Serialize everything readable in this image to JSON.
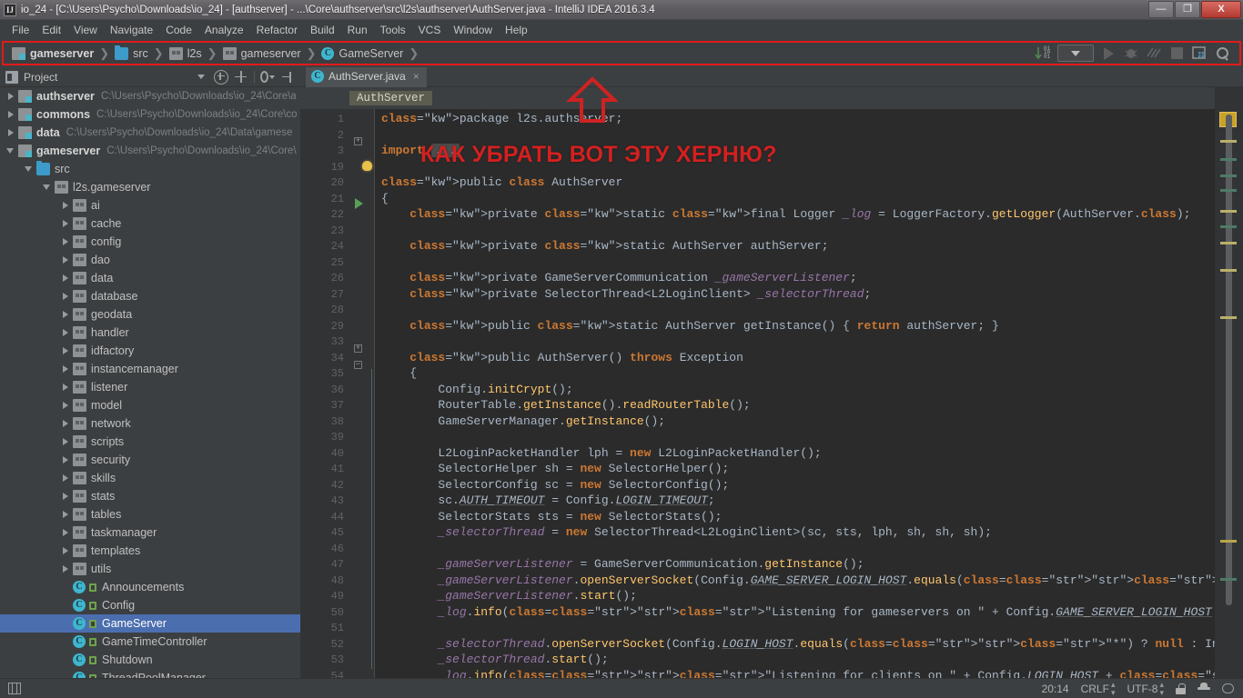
{
  "window": {
    "app_icon": "intellij-idea-icon",
    "title": "io_24 - [C:\\Users\\Psycho\\Downloads\\io_24] - [authserver] - ...\\Core\\authserver\\src\\l2s\\authserver\\AuthServer.java - IntelliJ IDEA 2016.3.4",
    "minimize_label": "—",
    "maximize_label": "❐",
    "close_label": "X"
  },
  "menubar": {
    "items": [
      "File",
      "Edit",
      "View",
      "Navigate",
      "Code",
      "Analyze",
      "Refactor",
      "Build",
      "Run",
      "Tools",
      "VCS",
      "Window",
      "Help"
    ]
  },
  "navbar": {
    "highlight_color": "#e01b1b",
    "crumbs": [
      {
        "label": "gameserver",
        "icon": "module-icon",
        "bold": true
      },
      {
        "label": "src",
        "icon": "source-folder-icon",
        "bold": false
      },
      {
        "label": "l2s",
        "icon": "package-icon",
        "bold": false
      },
      {
        "label": "gameserver",
        "icon": "package-icon",
        "bold": false
      },
      {
        "label": "GameServer",
        "icon": "java-class-icon",
        "bold": false
      }
    ],
    "separator": "❯",
    "tools": [
      "sort-updown-icon",
      "run-configuration-selector",
      "run-icon",
      "debug-icon",
      "coverage-icon",
      "stop-icon",
      "project-structure-icon",
      "search-everywhere-icon"
    ]
  },
  "toolwindow": {
    "icon": "project-tool-icon",
    "title": "Project",
    "dropdown": "▾",
    "actions": [
      "expand-all-icon",
      "collapse-all-icon",
      "settings-gear-icon",
      "hide-icon"
    ]
  },
  "editor_tab": {
    "icon": "java-class-icon",
    "name": "AuthServer.java",
    "close": "×"
  },
  "project_tree": {
    "nodes": [
      {
        "indent": 0,
        "toggle": "right",
        "icon": "module-icon",
        "label": "authserver",
        "bold": true,
        "path": "C:\\Users\\Psycho\\Downloads\\io_24\\Core\\a"
      },
      {
        "indent": 0,
        "toggle": "right",
        "icon": "module-icon",
        "label": "commons",
        "bold": true,
        "path": "C:\\Users\\Psycho\\Downloads\\io_24\\Core\\co"
      },
      {
        "indent": 0,
        "toggle": "right",
        "icon": "module-icon",
        "label": "data",
        "bold": true,
        "path": "C:\\Users\\Psycho\\Downloads\\io_24\\Data\\gamese"
      },
      {
        "indent": 0,
        "toggle": "down",
        "icon": "module-icon",
        "label": "gameserver",
        "bold": true,
        "path": "C:\\Users\\Psycho\\Downloads\\io_24\\Core\\"
      },
      {
        "indent": 1,
        "toggle": "down",
        "icon": "source-folder-icon",
        "label": "src",
        "bold": false,
        "path": ""
      },
      {
        "indent": 2,
        "toggle": "down",
        "icon": "package-icon",
        "label": "l2s.gameserver",
        "bold": false,
        "path": ""
      },
      {
        "indent": 3,
        "toggle": "right",
        "icon": "package-icon",
        "label": "ai",
        "bold": false,
        "path": ""
      },
      {
        "indent": 3,
        "toggle": "right",
        "icon": "package-icon",
        "label": "cache",
        "bold": false,
        "path": ""
      },
      {
        "indent": 3,
        "toggle": "right",
        "icon": "package-icon",
        "label": "config",
        "bold": false,
        "path": ""
      },
      {
        "indent": 3,
        "toggle": "right",
        "icon": "package-icon",
        "label": "dao",
        "bold": false,
        "path": ""
      },
      {
        "indent": 3,
        "toggle": "right",
        "icon": "package-icon",
        "label": "data",
        "bold": false,
        "path": ""
      },
      {
        "indent": 3,
        "toggle": "right",
        "icon": "package-icon",
        "label": "database",
        "bold": false,
        "path": ""
      },
      {
        "indent": 3,
        "toggle": "right",
        "icon": "package-icon",
        "label": "geodata",
        "bold": false,
        "path": ""
      },
      {
        "indent": 3,
        "toggle": "right",
        "icon": "package-icon",
        "label": "handler",
        "bold": false,
        "path": ""
      },
      {
        "indent": 3,
        "toggle": "right",
        "icon": "package-icon",
        "label": "idfactory",
        "bold": false,
        "path": ""
      },
      {
        "indent": 3,
        "toggle": "right",
        "icon": "package-icon",
        "label": "instancemanager",
        "bold": false,
        "path": ""
      },
      {
        "indent": 3,
        "toggle": "right",
        "icon": "package-icon",
        "label": "listener",
        "bold": false,
        "path": ""
      },
      {
        "indent": 3,
        "toggle": "right",
        "icon": "package-icon",
        "label": "model",
        "bold": false,
        "path": ""
      },
      {
        "indent": 3,
        "toggle": "right",
        "icon": "package-icon",
        "label": "network",
        "bold": false,
        "path": ""
      },
      {
        "indent": 3,
        "toggle": "right",
        "icon": "package-icon",
        "label": "scripts",
        "bold": false,
        "path": ""
      },
      {
        "indent": 3,
        "toggle": "right",
        "icon": "package-icon",
        "label": "security",
        "bold": false,
        "path": ""
      },
      {
        "indent": 3,
        "toggle": "right",
        "icon": "package-icon",
        "label": "skills",
        "bold": false,
        "path": ""
      },
      {
        "indent": 3,
        "toggle": "right",
        "icon": "package-icon",
        "label": "stats",
        "bold": false,
        "path": ""
      },
      {
        "indent": 3,
        "toggle": "right",
        "icon": "package-icon",
        "label": "tables",
        "bold": false,
        "path": ""
      },
      {
        "indent": 3,
        "toggle": "right",
        "icon": "package-icon",
        "label": "taskmanager",
        "bold": false,
        "path": ""
      },
      {
        "indent": 3,
        "toggle": "right",
        "icon": "package-icon",
        "label": "templates",
        "bold": false,
        "path": ""
      },
      {
        "indent": 3,
        "toggle": "right",
        "icon": "package-icon",
        "label": "utils",
        "bold": false,
        "path": ""
      },
      {
        "indent": 3,
        "toggle": "none",
        "icon": "java-class-icon",
        "label": "Announcements",
        "bold": false,
        "path": ""
      },
      {
        "indent": 3,
        "toggle": "none",
        "icon": "java-class-icon",
        "label": "Config",
        "bold": false,
        "path": ""
      },
      {
        "indent": 3,
        "toggle": "none",
        "icon": "java-class-icon",
        "label": "GameServer",
        "bold": false,
        "path": "",
        "selected": true
      },
      {
        "indent": 3,
        "toggle": "none",
        "icon": "java-class-icon",
        "label": "GameTimeController",
        "bold": false,
        "path": ""
      },
      {
        "indent": 3,
        "toggle": "none",
        "icon": "java-class-icon",
        "label": "Shutdown",
        "bold": false,
        "path": ""
      },
      {
        "indent": 3,
        "toggle": "none",
        "icon": "java-class-icon",
        "label": "ThreadPoolManager",
        "bold": false,
        "path": ""
      }
    ]
  },
  "editor": {
    "breadcrumb_chip": "AuthServer",
    "line_numbers": [
      "1",
      "2",
      "3",
      "19",
      "20",
      "21",
      "22",
      "23",
      "24",
      "25",
      "26",
      "27",
      "28",
      "29",
      "33",
      "34",
      "35",
      "36",
      "37",
      "38",
      "39",
      "40",
      "41",
      "42",
      "43",
      "44",
      "45",
      "46",
      "47",
      "48",
      "49",
      "50",
      "51",
      "52",
      "53",
      "54"
    ],
    "code_lines": [
      "package l2s.authserver;",
      "",
      "import ...",
      "",
      "public class AuthServer",
      "{",
      "    private static final Logger _log = LoggerFactory.getLogger(AuthServer.class);",
      "",
      "    private static AuthServer authServer;",
      "",
      "    private GameServerCommunication _gameServerListener;",
      "    private SelectorThread<L2LoginClient> _selectorThread;",
      "",
      "    public static AuthServer getInstance() { return authServer; }",
      "",
      "    public AuthServer() throws Exception",
      "    {",
      "        Config.initCrypt();",
      "        RouterTable.getInstance().readRouterTable();",
      "        GameServerManager.getInstance();",
      "",
      "        L2LoginPacketHandler lph = new L2LoginPacketHandler();",
      "        SelectorHelper sh = new SelectorHelper();",
      "        SelectorConfig sc = new SelectorConfig();",
      "        sc.AUTH_TIMEOUT = Config.LOGIN_TIMEOUT;",
      "        SelectorStats sts = new SelectorStats();",
      "        _selectorThread = new SelectorThread<L2LoginClient>(sc, sts, lph, sh, sh, sh);",
      "",
      "        _gameServerListener = GameServerCommunication.getInstance();",
      "        _gameServerListener.openServerSocket(Config.GAME_SERVER_LOGIN_HOST.equals(\"*\") ? null : InetAddress.getByName(Config.GAME_SERVER_LOGIN_HOST), Config.GAME_SERVER_LOGIN_PORT);",
      "        _gameServerListener.start();",
      "        _log.info(\"Listening for gameservers on \" + Config.GAME_SERVER_LOGIN_HOST + \":\" + Config.GAME_SERVER_LOGIN_PORT);",
      "",
      "        _selectorThread.openServerSocket(Config.LOGIN_HOST.equals(\"*\") ? null : InetAddress.getByName(Config.LOGIN_HOST), Config.PORT_LOGIN);",
      "        _selectorThread.start();",
      "        _log.info(\"Listening for clients on \" + Config.LOGIN_HOST + \":\" + Config.PORT_LOGIN);"
    ]
  },
  "annotation": {
    "question_text": "КАК УБРАТЬ ВОТ ЭТУ ХЕРНЮ?",
    "question_color": "#d42020",
    "arrow": "up-arrow-annotation"
  },
  "statusbar": {
    "left_icon": "toggle-toolwindows-icon",
    "caret_position": "20:14",
    "line_separator": "CRLF",
    "encoding": "UTF-8",
    "lock_icon": "read-only-lock-icon",
    "inspector_icon": "inspection-hector-icon",
    "notifications_icon": "notifications-icon"
  }
}
